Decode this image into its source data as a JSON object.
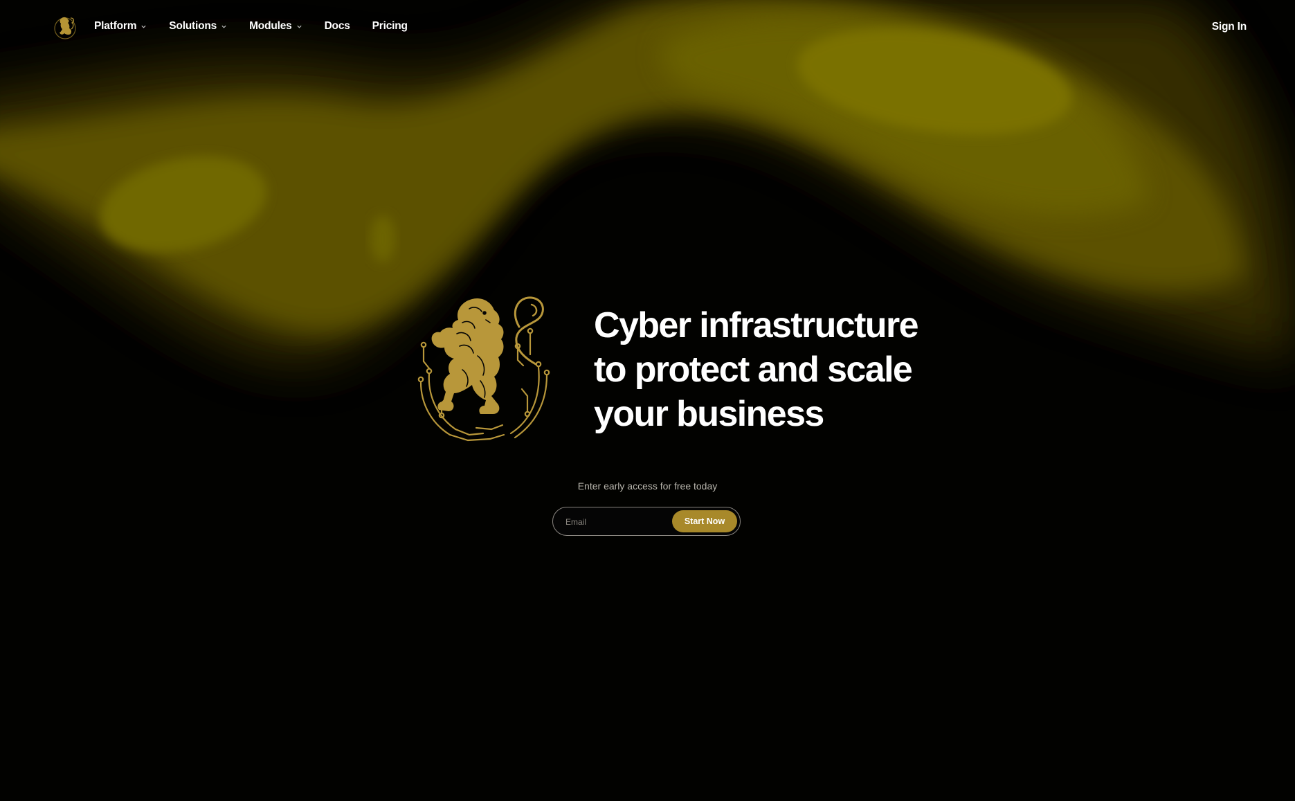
{
  "nav": {
    "logo_icon": "lion-crest-icon",
    "items": [
      {
        "label": "Platform",
        "has_dropdown": true
      },
      {
        "label": "Solutions",
        "has_dropdown": true
      },
      {
        "label": "Modules",
        "has_dropdown": true
      },
      {
        "label": "Docs",
        "has_dropdown": false
      },
      {
        "label": "Pricing",
        "has_dropdown": false
      }
    ],
    "sign_in": "Sign In"
  },
  "hero": {
    "emblem_icon": "lion-circuit-emblem-icon",
    "headline_lines": [
      "Cyber infrastructure",
      "to protect and scale",
      "your business"
    ],
    "subtext": "Enter early access for free today",
    "email_placeholder": "Email",
    "cta_label": "Start Now"
  },
  "colors": {
    "background": "#020200",
    "accent_gold": "#a8892a",
    "glow_yellow": "#7a7000",
    "text": "#ffffff"
  }
}
